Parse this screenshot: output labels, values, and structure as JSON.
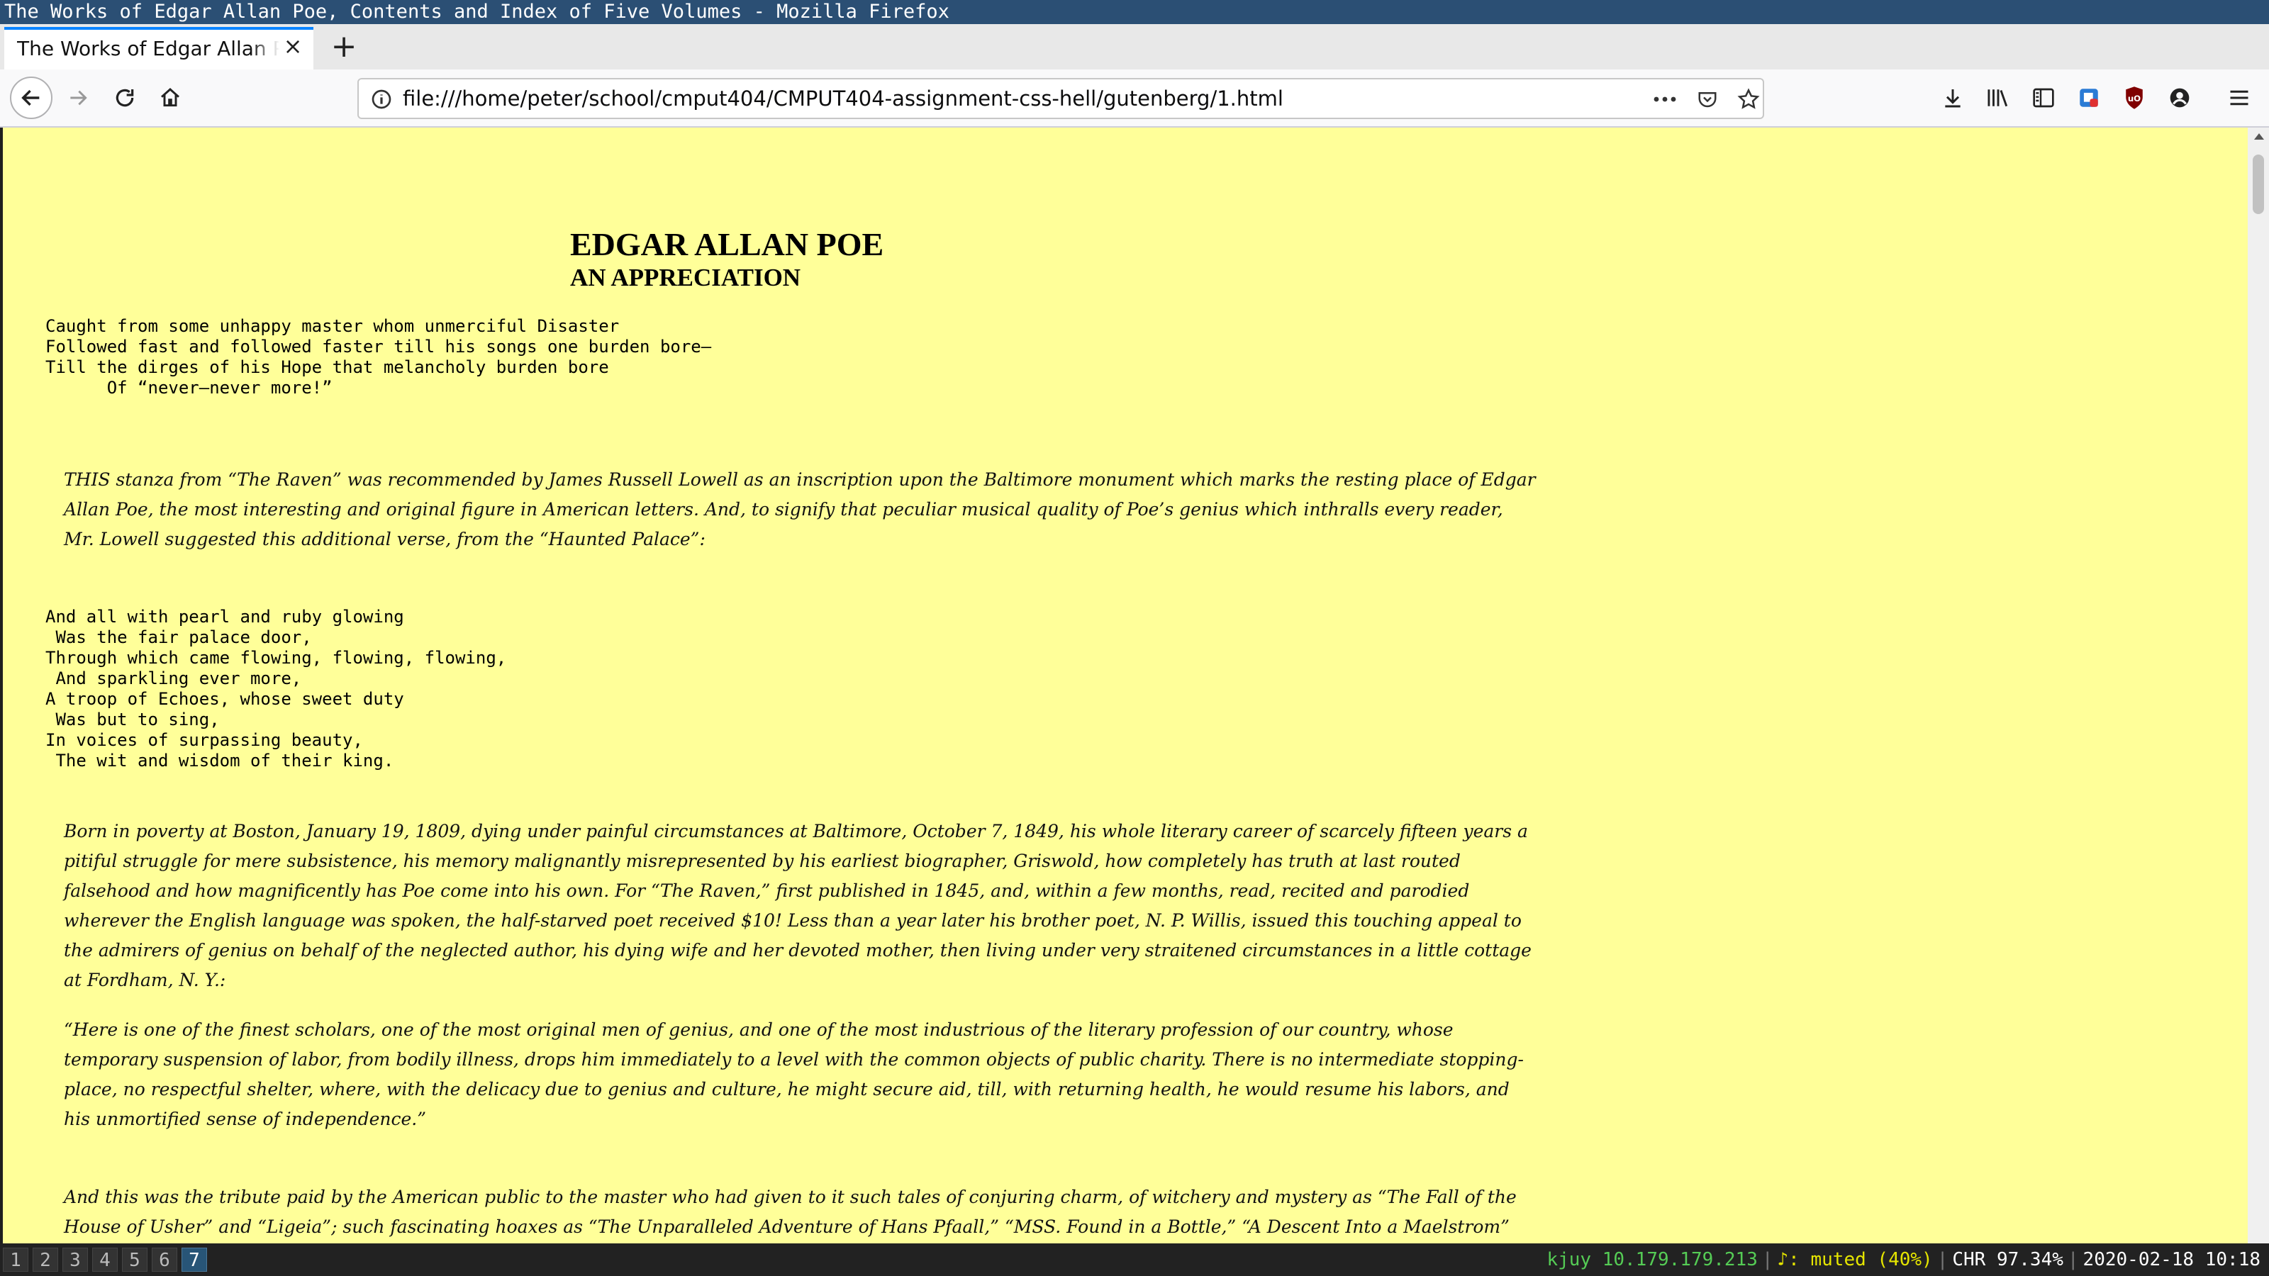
{
  "window": {
    "title": "The Works of Edgar Allan Poe, Contents and Index of Five Volumes - Mozilla Firefox"
  },
  "tab": {
    "title": "The Works of Edgar Allan Poe, Contents and Index of Five Volumes",
    "close_icon": "×",
    "new_tab_icon": "+"
  },
  "url": "file:///home/peter/school/cmput404/CMPUT404-assignment-css-hell/gutenberg/1.html",
  "icons": {
    "back": "arrow-left-icon",
    "forward": "arrow-right-icon",
    "reload": "reload-icon",
    "home": "home-icon",
    "info": "info-icon",
    "more": "ellipsis-icon",
    "pocket": "pocket-icon",
    "bookmark": "star-icon",
    "downloads": "download-icon",
    "library": "library-icon",
    "sidebar": "sidebar-icon",
    "ext1": "extension-icon",
    "ublock": "ublock-icon",
    "account": "account-icon",
    "menu": "hamburger-menu-icon"
  },
  "page": {
    "heading": "EDGAR ALLAN POE",
    "subheading": "AN APPRECIATION",
    "poem1": [
      "Caught from some unhappy master whom unmerciful Disaster",
      "Followed fast and followed faster till his songs one burden bore—",
      "Till the dirges of his Hope that melancholy burden bore",
      "      Of “never—never more!”"
    ],
    "para1": "THIS stanza from “The Raven” was recommended by James Russell Lowell as an inscription upon the Baltimore monument which marks the resting place of Edgar Allan Poe, the most interesting and original figure in American letters. And, to signify that peculiar musical quality of Poe’s genius which inthralls every reader, Mr. Lowell suggested this additional verse, from the “Haunted Palace”:",
    "poem2": [
      "And all with pearl and ruby glowing",
      " Was the fair palace door,",
      "Through which came flowing, flowing, flowing,",
      " And sparkling ever more,",
      "A troop of Echoes, whose sweet duty",
      " Was but to sing,",
      "In voices of surpassing beauty,",
      " The wit and wisdom of their king."
    ],
    "para2": "Born in poverty at Boston, January 19, 1809, dying under painful circumstances at Baltimore, October 7, 1849, his whole literary career of scarcely fifteen years a pitiful struggle for mere subsistence, his memory malignantly misrepresented by his earliest biographer, Griswold, how completely has truth at last routed falsehood and how magnificently has Poe come into his own. For “The Raven,” first published in 1845, and, within a few months, read, recited and parodied wherever the English language was spoken, the half-starved poet received $10! Less than a year later his brother poet, N. P. Willis, issued this touching appeal to the admirers of genius on behalf of the neglected author, his dying wife and her devoted mother, then living under very straitened circumstances in a little cottage at Fordham, N. Y.:",
    "para3": "“Here is one of the finest scholars, one of the most original men of genius, and one of the most industrious of the literary profession of our country, whose temporary suspension of labor, from bodily illness, drops him immediately to a level with the common objects of public charity. There is no intermediate stopping-place, no respectful shelter, where, with the delicacy due to genius and culture, he might secure aid, till, with returning health, he would resume his labors, and his unmortified sense of independence.”",
    "para4": "And this was the tribute paid by the American public to the master who had given to it such tales of conjuring charm, of witchery and mystery as “The Fall of the House of Usher” and “Ligeia”; such fascinating hoaxes as “The Unparalleled Adventure of Hans Pfaall,” “MSS. Found in a Bottle,” “A Descent Into a Maelstrom” and “The"
  },
  "statusbar": {
    "workspaces": [
      "1",
      "2",
      "3",
      "4",
      "5",
      "6",
      "7"
    ],
    "active_workspace": "7",
    "network": "kjuy 10.179.179.213",
    "volume": "♪: muted (40%)",
    "battery": "CHR 97.34%",
    "datetime": "2020-02-18 10:18"
  },
  "colors": {
    "page_bg": "#ffff99",
    "titlebar": "#2b4f74",
    "status_green": "#55cc55",
    "status_yellow": "#e5e500",
    "accent": "#0a84ff"
  }
}
